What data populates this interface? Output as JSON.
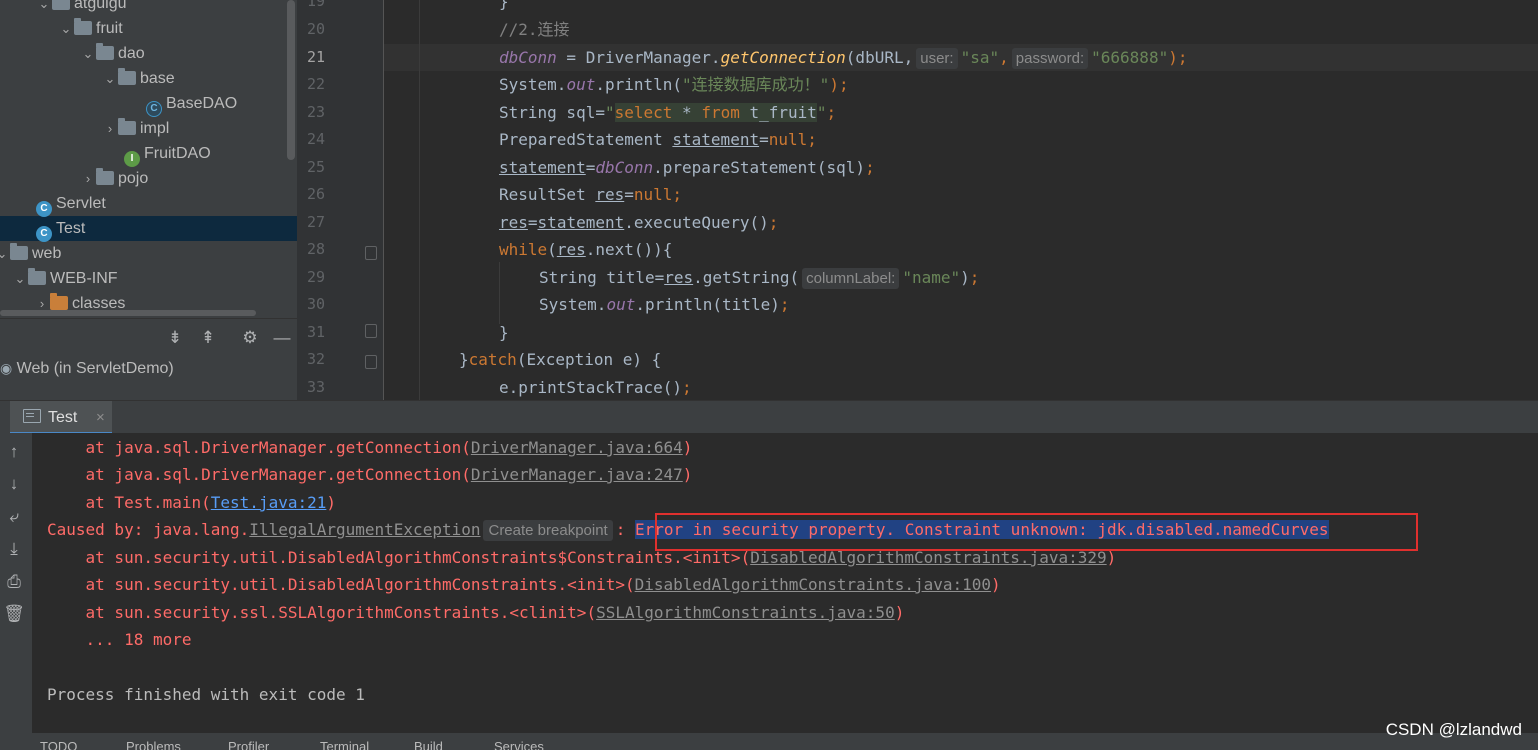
{
  "project_tree": {
    "items": [
      {
        "label": "atguigu"
      },
      {
        "label": "fruit"
      },
      {
        "label": "dao"
      },
      {
        "label": "base"
      },
      {
        "label": "BaseDAO"
      },
      {
        "label": "impl"
      },
      {
        "label": "FruitDAO"
      },
      {
        "label": "pojo"
      },
      {
        "label": "Servlet"
      },
      {
        "label": "Test"
      },
      {
        "label": "web"
      },
      {
        "label": "WEB-INF"
      },
      {
        "label": "classes"
      }
    ]
  },
  "services": {
    "item_label": "Web (in ServletDemo)"
  },
  "editor": {
    "line_numbers": [
      "19",
      "20",
      "21",
      "22",
      "23",
      "24",
      "25",
      "26",
      "27",
      "28",
      "29",
      "30",
      "31",
      "32",
      "33"
    ],
    "code": {
      "l19": "}",
      "l20": "//2.连接",
      "l21_var": "dbConn",
      "l21_eq": " = DriverManager.",
      "l21_method": "getConnection",
      "l21_open": "(dbURL,",
      "l21_hint_user": "user:",
      "l21_user_val": "\"sa\"",
      "l21_comma": ",",
      "l21_hint_password": "password:",
      "l21_pass_val": "\"666888\"",
      "l21_close": ");",
      "l22_a": "System.",
      "l22_out": "out",
      "l22_b": ".println(",
      "l22_str": "\"连接数据库成功！\"",
      "l22_c": ");",
      "l23_a": "String sql=",
      "l23_q1": "\"",
      "l23_select": "select",
      "l23_star": " * ",
      "l23_from": "from",
      "l23_table": " t_fruit",
      "l23_q2": "\"",
      "l23_end": ";",
      "l24_a": "PreparedStatement ",
      "l24_var": "statement",
      "l24_eq": "=",
      "l24_null": "null",
      "l24_end": ";",
      "l25_var": "statement",
      "l25_eq": "=",
      "l25_conn": "dbConn",
      "l25_rest": ".prepareStatement(sql)",
      "l25_end": ";",
      "l26_a": "ResultSet ",
      "l26_var": "res",
      "l26_eq": "=",
      "l26_null": "null",
      "l26_end": ";",
      "l27_var": "res",
      "l27_eq": "=",
      "l27_stmt": "statement",
      "l27_rest": ".executeQuery()",
      "l27_end": ";",
      "l28_kw": "while",
      "l28_open": "(",
      "l28_var": "res",
      "l28_rest": ".next()){",
      "l29_a": "String title=",
      "l29_var": "res",
      "l29_b": ".getString(",
      "l29_hint": "columnLabel:",
      "l29_str": "\"name\"",
      "l29_c": ")",
      "l29_end": ";",
      "l30_a": "System.",
      "l30_out": "out",
      "l30_b": ".println(title)",
      "l30_end": ";",
      "l31": "}",
      "l32_a": "}",
      "l32_kw": "catch",
      "l32_b": "(Exception e) {",
      "l33_a": "e.printStackTrace()",
      "l33_end": ";"
    }
  },
  "run_window": {
    "tab_label": "Test",
    "tab_close": "×",
    "console": {
      "l1_a": "    at java.sql.DriverManager.getConnection(",
      "l1_link": "DriverManager.java:664",
      "l1_b": ")",
      "l2_a": "    at java.sql.DriverManager.getConnection(",
      "l2_link": "DriverManager.java:247",
      "l2_b": ")",
      "l3_a": "    at Test.main(",
      "l3_link": "Test.java:21",
      "l3_b": ")",
      "l4_a": "Caused by: java.lang.",
      "l4_link": "IllegalArgumentException",
      "l4_bp": "Create breakpoint",
      "l4_colon": ": ",
      "l4_msg": "Error in security property. Constraint unknown: jdk.disabled.namedCurves",
      "l5_a": "    at sun.security.util.DisabledAlgorithmConstraints$Constraints.<init>(",
      "l5_link": "DisabledAlgorithmConstraints.java:329",
      "l5_b": ")",
      "l6_a": "    at sun.security.util.DisabledAlgorithmConstraints.<init>(",
      "l6_link": "DisabledAlgorithmConstraints.java:100",
      "l6_b": ")",
      "l7_a": "    at sun.security.ssl.SSLAlgorithmConstraints.<clinit>(",
      "l7_link": "SSLAlgorithmConstraints.java:50",
      "l7_b": ")",
      "l8": "    ... 18 more",
      "l9": "Process finished with exit code 1"
    }
  },
  "bottom_bar": {
    "items": [
      "TODO",
      "Problems",
      "Profiler",
      "Terminal",
      "Build",
      "Services"
    ]
  },
  "watermark": "CSDN @lzlandwd",
  "colors": {
    "error_text": "#ff6b68",
    "highlight_box": "#e0302e",
    "selection": "#214283"
  }
}
